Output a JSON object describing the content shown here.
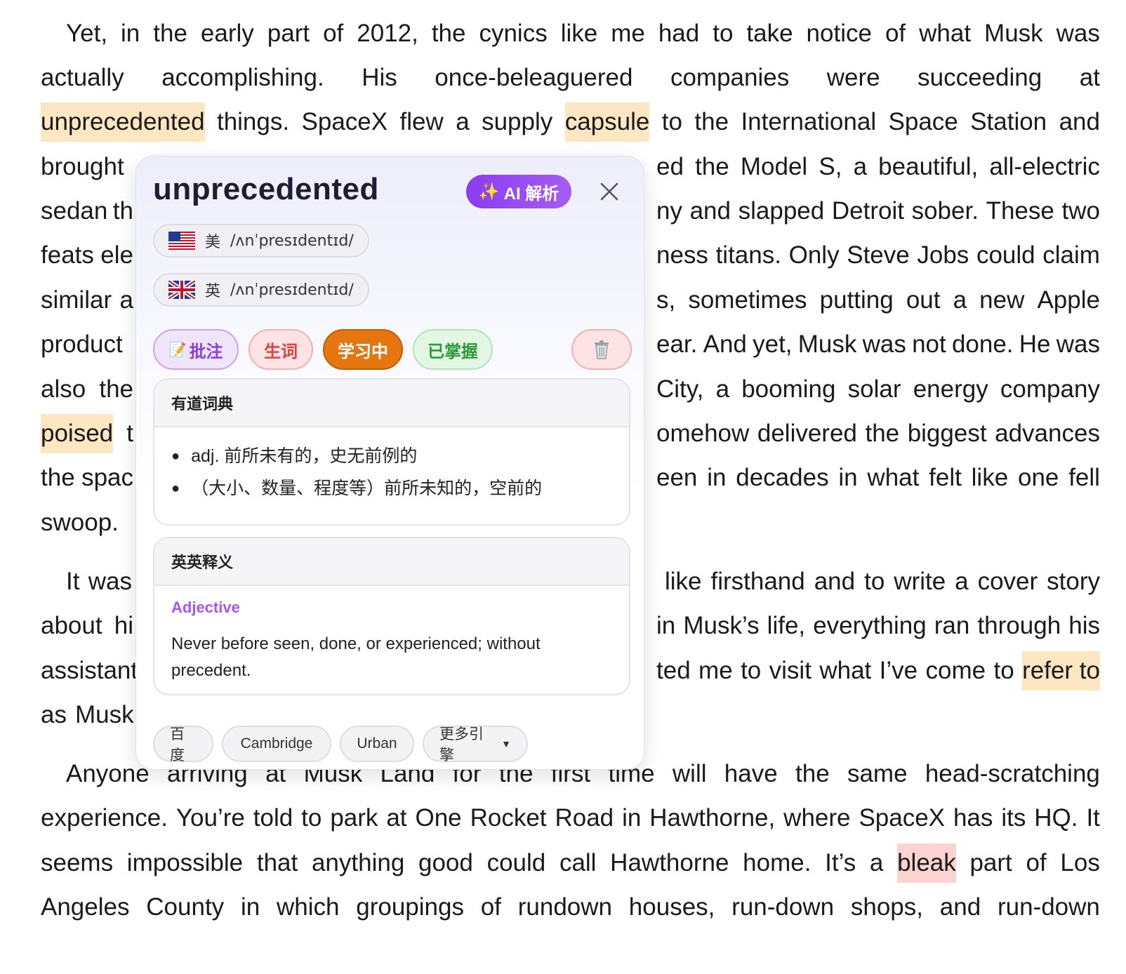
{
  "paragraphs": {
    "lines": [
      {
        "segments": [
          [
            "Yet,",
            "in",
            "the",
            "early",
            "part",
            "of",
            "2012,",
            "the",
            "cynics",
            "like",
            "me",
            "had",
            "to",
            "take",
            "notice",
            "of",
            "what",
            "Musk",
            "was"
          ]
        ]
      },
      {
        "segments": [
          [
            "actually",
            "accomplishing.",
            "His",
            "once-beleaguered",
            "companies",
            "were",
            "succeeding",
            "at"
          ]
        ]
      },
      {
        "segments": [
          [
            "unprecedented",
            "things.",
            "SpaceX",
            "flew",
            "a",
            "supply",
            "capsule",
            "to",
            "the",
            "International",
            "Space",
            "Station",
            "and"
          ]
        ]
      },
      {
        "segments": [
          [
            "brought"
          ],
          [
            "ed",
            "the",
            "Model",
            "S,",
            "a",
            "beautiful,",
            "all-electric"
          ]
        ]
      },
      {
        "segments": [
          [
            "sedan",
            "th"
          ],
          [
            "ny",
            "and",
            "slapped",
            "Detroit",
            "sober.",
            "These",
            "two"
          ]
        ]
      },
      {
        "segments": [
          [
            "feats",
            "ele"
          ],
          [
            "ness",
            "titans.",
            "Only",
            "Steve",
            "Jobs",
            "could",
            "claim"
          ]
        ]
      },
      {
        "segments": [
          [
            "similar",
            "a"
          ],
          [
            "s,",
            "sometimes",
            "putting",
            "out",
            "a",
            "new",
            "Apple"
          ]
        ]
      },
      {
        "segments": [
          [
            "product"
          ],
          [
            "ear.",
            "And",
            "yet,",
            "Musk",
            "was",
            "not",
            "done.",
            "He",
            "was"
          ]
        ]
      },
      {
        "segments": [
          [
            "also",
            "the"
          ],
          [
            "City,",
            "a",
            "booming",
            "solar",
            "energy",
            "company"
          ]
        ]
      },
      {
        "segments": [
          [
            "poised",
            "t"
          ],
          [
            "omehow",
            "delivered",
            "the",
            "biggest",
            "advances"
          ]
        ]
      },
      {
        "segments": [
          [
            "the",
            "spac"
          ],
          [
            "een",
            "in",
            "decades",
            "in",
            "what",
            "felt",
            "like",
            "one",
            "fell"
          ]
        ]
      },
      {
        "segments": [
          [
            "swoop."
          ]
        ]
      },
      {
        "segments": [
          [
            "It",
            "was"
          ],
          [
            "like",
            "firsthand",
            "and",
            "to",
            "write",
            "a",
            "cover",
            "story"
          ]
        ]
      },
      {
        "segments": [
          [
            "about",
            "hi"
          ],
          [
            "in",
            "Musk’s",
            "life,",
            "everything",
            "ran",
            "through",
            "his"
          ]
        ]
      },
      {
        "segments": [
          [
            "assistant"
          ],
          [
            "ted",
            "me",
            "to",
            "visit",
            "what",
            "I’ve",
            "come",
            "to",
            "refer to"
          ]
        ]
      },
      {
        "segments": [
          [
            "as",
            "Musk"
          ]
        ]
      },
      {
        "segments": [
          [
            "Anyone",
            "arriving",
            "at",
            "Musk",
            "Land",
            "for",
            "the",
            "first",
            "time",
            "will",
            "have",
            "the",
            "same",
            "head-scratching"
          ]
        ]
      },
      {
        "segments": [
          [
            "experience.",
            "You’re",
            "told",
            "to",
            "park",
            "at",
            "One",
            "Rocket",
            "Road",
            "in",
            "Hawthorne,",
            "where",
            "SpaceX",
            "has",
            "its",
            "HQ.",
            "It"
          ]
        ]
      },
      {
        "segments": [
          [
            "seems",
            "impossible",
            "that",
            "anything",
            "good",
            "could",
            "call",
            "Hawthorne",
            "home.",
            "It’s",
            "a",
            "bleak",
            "part",
            "of",
            "Los"
          ]
        ]
      },
      {
        "segments": [
          [
            "Angeles",
            "County",
            "in",
            "which",
            "groupings",
            "of",
            "rundown",
            "houses,",
            "run-down",
            "shops,",
            "and",
            "run-down"
          ]
        ]
      }
    ],
    "highlights_orange": [
      "unprecedented",
      "capsule",
      "poised",
      "refer to"
    ],
    "highlights_red": [
      "bleak"
    ]
  },
  "popup": {
    "headword": "unprecedented",
    "ai_button": {
      "icon": "sparkles-icon",
      "label": "AI 解析"
    },
    "pronunciations": [
      {
        "flag": "us-flag-icon",
        "region": "美",
        "ipa": "/ʌnˈpresɪdentɪd/"
      },
      {
        "flag": "uk-flag-icon",
        "region": "英",
        "ipa": "/ʌnˈpresɪdentɪd/"
      }
    ],
    "tags": {
      "note": "批注",
      "new_word": "生词",
      "learning": "学习中",
      "mastered": "已掌握"
    },
    "youdao": {
      "title": "有道词典",
      "items": [
        "adj. 前所未有的，史无前例的",
        "（大小、数量、程度等）前所未知的，空前的"
      ]
    },
    "english": {
      "title": "英英释义",
      "part_of_speech": "Adjective",
      "definition": "Never before seen, done, or experienced; without precedent."
    },
    "engines": [
      "百度",
      "Cambridge",
      "Urban",
      "更多引擎"
    ],
    "colors": {
      "accent": "#8b3cf0",
      "learning": "#e6760f",
      "highlight_orange": "#fde7c2",
      "highlight_red": "#fbd3d3"
    }
  }
}
